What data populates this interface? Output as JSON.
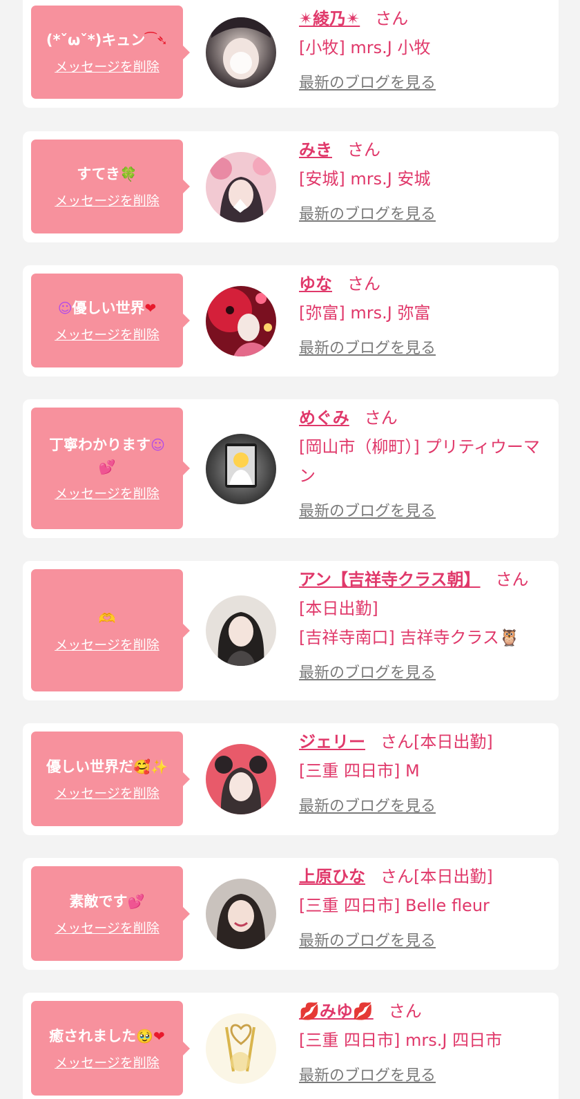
{
  "delete_label": "メッセージを削除",
  "blog_label": "最新のブログを見る",
  "honorific": "さん",
  "colors": {
    "page_bg": "#f3f3f3",
    "card_bg": "#ffffff",
    "bubble_bg": "#f7919d",
    "accent_text": "#e0386a",
    "link_gray": "#7a7a7a"
  },
  "cards": [
    {
      "message": "(*ˇωˇ*)キュン",
      "message_emoji": "⁀➴",
      "name": "✴綾乃✴",
      "attendance": "",
      "shop": "[小牧] mrs.J 小牧",
      "avatar_icon": "avatar-photo"
    },
    {
      "message": "すてき",
      "message_emoji": "🍀",
      "name": "みき",
      "attendance": "",
      "shop": "[安城] mrs.J 安城",
      "avatar_icon": "avatar-photo"
    },
    {
      "message_emoji_pre": "☺",
      "message": "優しい世界",
      "message_emoji": "❤",
      "name": "ゆな",
      "attendance": "",
      "shop": "[弥富] mrs.J 弥富",
      "avatar_icon": "avatar-photo"
    },
    {
      "message": "丁寧わかります",
      "message_emoji": "☺",
      "message_line2": "💕",
      "name": "めぐみ",
      "attendance": "",
      "shop": "[岡山市（柳町）] プリティウーマン",
      "avatar_icon": "avatar-photo"
    },
    {
      "message": "",
      "message_emoji": "🫶",
      "name": "アン【吉祥寺クラス朝】",
      "attendance": "[本日出勤]",
      "shop": "[吉祥寺南口] 吉祥寺クラス🦉",
      "avatar_icon": "avatar-photo"
    },
    {
      "message": "優しい世界だ",
      "message_emoji": "🥰✨",
      "name": "ジェリー",
      "attendance": "[本日出勤]",
      "shop": "[三重 四日市] M",
      "avatar_icon": "avatar-photo"
    },
    {
      "message": "素敵です",
      "message_emoji": "💕",
      "name": "上原ひな",
      "attendance": "[本日出勤]",
      "shop": "[三重 四日市] Belle fleur",
      "avatar_icon": "avatar-photo"
    },
    {
      "message": "癒されました",
      "message_emoji": "🥹❤",
      "name": "💋みゆ💋",
      "attendance": "",
      "shop": "[三重 四日市] mrs.J 四日市",
      "avatar_icon": "avatar-photo"
    }
  ]
}
